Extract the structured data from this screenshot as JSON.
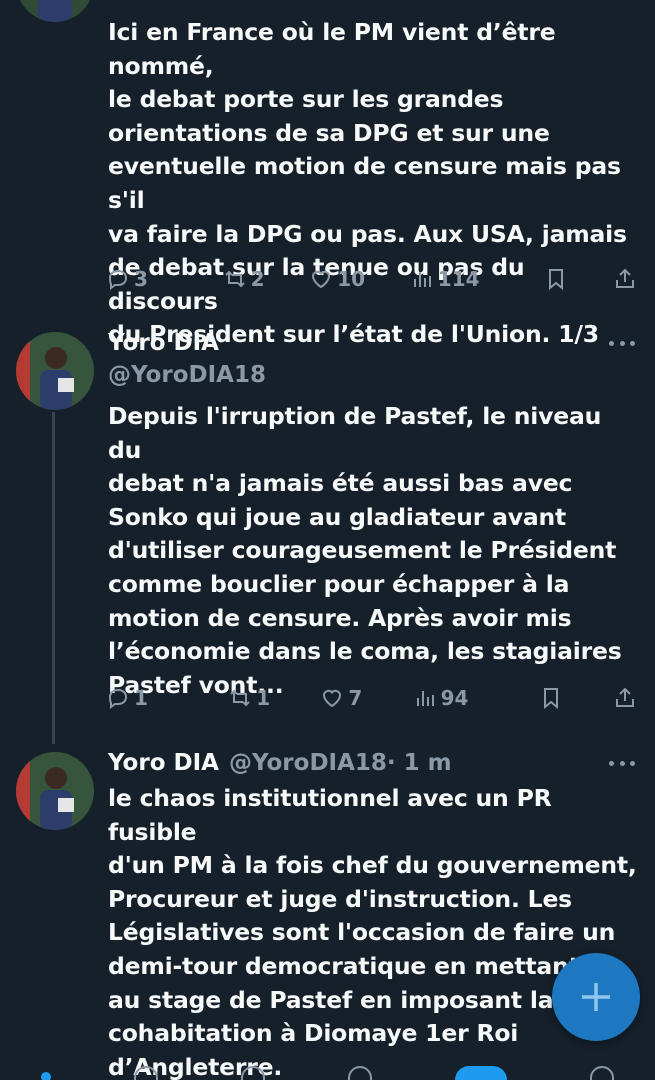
{
  "tweets": [
    {
      "text": "Ici en France où le PM vient d’être nommé,\nle debat porte sur les grandes\norientations de sa DPG  et sur une\neventuelle motion de censure mais pas s'il\nva faire la DPG ou pas. Aux USA, jamais\nde debat sur la tenue ou pas du discours\ndu President sur l’état de l'Union. 1/3",
      "replies": "3",
      "reposts": "2",
      "likes": "10",
      "views": "114"
    },
    {
      "name": "Yoro DIA",
      "handle": "@YoroDIA18",
      "text": "Depuis l'irruption de Pastef, le niveau du\ndebat n'a jamais été aussi bas avec\nSonko qui joue au gladiateur avant\nd'utiliser  courageusement le Président\ncomme bouclier pour échapper à la\nmotion de censure.  Après avoir mis\nl’économie dans le coma, les stagiaires\nPastef vont...",
      "replies": "1",
      "reposts": "1",
      "likes": "7",
      "views": "94"
    },
    {
      "name": "Yoro DIA",
      "handle": "@YoroDIA18",
      "time": " · 1 m",
      "text": "le chaos institutionnel avec un PR fusible\nd'un PM à la fois chef du gouvernement,\nProcureur et juge d'instruction. Les\nLégislatives sont l'occasion de faire un\ndemi-tour democratique en mettant fin\nau stage de Pastef en imposant  la\ncohabitation à Diomaye 1er Roi\nd’Angleterre."
    }
  ],
  "icons": {
    "reply": "reply-icon",
    "repost": "repost-icon",
    "like": "heart-icon",
    "views": "views-icon",
    "bookmark": "bookmark-icon",
    "share": "share-icon",
    "more": "more-icon",
    "compose": "plus-icon"
  },
  "colors": {
    "background": "#15202b",
    "accent": "#1d9bf0",
    "muted": "#8b98a5",
    "fab": "#1d78c1"
  }
}
